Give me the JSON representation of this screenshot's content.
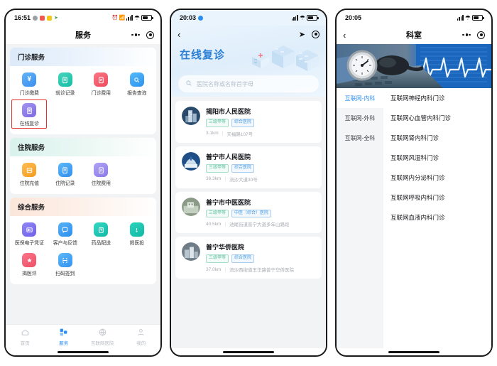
{
  "panels": [
    {
      "status": {
        "time": "16:51",
        "icons": [
          "chat-dot",
          "red-badge",
          "yellow-badge",
          "arrow"
        ]
      },
      "nav": {
        "title": "服务",
        "menu_icon": "more-dots-icon",
        "capsule_icon": "target-icon"
      },
      "sections": [
        {
          "title": "门诊服务",
          "theme": "blue",
          "items": [
            {
              "label": "门诊缴费",
              "icon": "yuan-icon",
              "color": "#4aa3f0"
            },
            {
              "label": "就诊记录",
              "icon": "clipboard-icon",
              "color": "#2cc5ae"
            },
            {
              "label": "门诊费用",
              "icon": "receipt-icon",
              "color": "#f4606c"
            },
            {
              "label": "报告查询",
              "icon": "search-doc-icon",
              "color": "#35a9f5"
            },
            {
              "label": "在线复诊",
              "icon": "video-visit-icon",
              "color": "#8c7ae6",
              "highlighted": true
            }
          ]
        },
        {
          "title": "住院服务",
          "theme": "green",
          "items": [
            {
              "label": "住院充值",
              "icon": "wallet-icon",
              "color": "#f5a623"
            },
            {
              "label": "住院记录",
              "icon": "clipboard-icon",
              "color": "#3fa9f5"
            },
            {
              "label": "住院费用",
              "icon": "bill-icon",
              "color": "#9b8cf0"
            }
          ]
        },
        {
          "title": "综合服务",
          "theme": "peach",
          "items": [
            {
              "label": "医保电子凭证",
              "icon": "card-icon",
              "color": "#7b6cf6"
            },
            {
              "label": "客户与反馈",
              "icon": "feedback-icon",
              "color": "#3fa0f0"
            },
            {
              "label": "药品配送",
              "icon": "delivery-icon",
              "color": "#1ec6b6"
            },
            {
              "label": "揭医投",
              "icon": "report-icon",
              "color": "#1fc2ae"
            },
            {
              "label": "揭医评",
              "icon": "star-icon",
              "color": "#f4637a"
            },
            {
              "label": "扫码签到",
              "icon": "scan-icon",
              "color": "#4aa3f0"
            }
          ]
        }
      ],
      "tabbar": [
        {
          "label": "首页",
          "icon": "home-icon",
          "active": false
        },
        {
          "label": "服务",
          "icon": "grid-icon",
          "active": true
        },
        {
          "label": "互联网医院",
          "icon": "globe-icon",
          "active": false
        },
        {
          "label": "我的",
          "icon": "person-icon",
          "active": false
        }
      ]
    },
    {
      "status": {
        "time": "20:03"
      },
      "nav": {
        "back_icon": "chevron-left-icon",
        "location_icon": "navigation-arrow-icon",
        "capsule_icon": "target-icon"
      },
      "hero_title": "在线复诊",
      "search": {
        "placeholder": "医院名称或名称首字母",
        "icon": "search-icon"
      },
      "hospitals": [
        {
          "name": "揭阳市人民医院",
          "level_tag": "三级甲等",
          "type_tag": "综合医院",
          "distance": "3.1km",
          "address": "天福路107号"
        },
        {
          "name": "普宁市人民医院",
          "level_tag": "三级甲等",
          "type_tag": "综合医院",
          "distance": "36.3km",
          "address": "流沙大道30号"
        },
        {
          "name": "普宁市中医医院",
          "level_tag": "三级甲等",
          "type_tag": "中医（综合）医院",
          "distance": "40.5km",
          "address": "池尾街道普宁大道多年山路段"
        },
        {
          "name": "普宁华侨医院",
          "level_tag": "三级甲等",
          "type_tag": "综合医院",
          "distance": "37.0km",
          "address": "流沙西街道玉华路普宁华侨医院"
        }
      ]
    },
    {
      "status": {
        "time": "20:05"
      },
      "nav": {
        "title": "科室",
        "back_icon": "chevron-left-icon",
        "menu_icon": "more-dots-icon",
        "capsule_icon": "target-icon"
      },
      "banner_icon": "blood-pressure-ecg-banner",
      "categories": [
        {
          "label": "互联网-内科",
          "active": true
        },
        {
          "label": "互联网-外科",
          "active": false
        },
        {
          "label": "互联网-全科",
          "active": false
        }
      ],
      "departments": [
        "互联网神经内科门诊",
        "互联网心血管内科门诊",
        "互联网肾内科门诊",
        "互联网风湿科门诊",
        "互联网内分泌科门诊",
        "互联网呼吸内科门诊",
        "互联网血液内科门诊"
      ]
    }
  ],
  "colors": {
    "accent": "#2b8ef0",
    "highlight_box": "#e6312a",
    "tag_level": "#5ec0a0",
    "tag_type": "#4d9de0"
  }
}
